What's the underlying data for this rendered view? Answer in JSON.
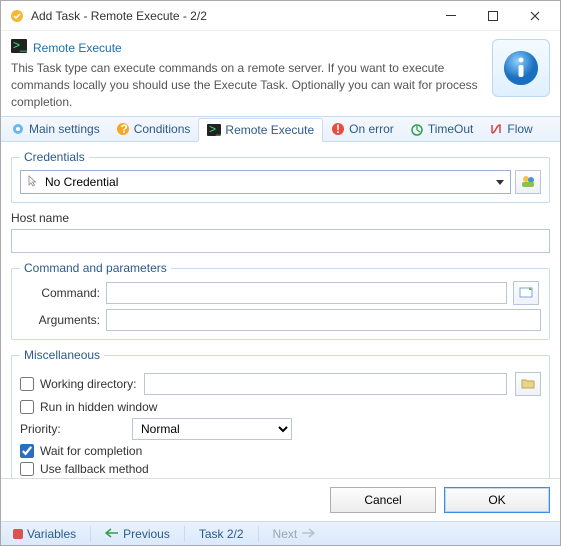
{
  "window": {
    "title": "Add Task - Remote Execute - 2/2"
  },
  "header": {
    "title": "Remote Execute",
    "description": "This Task type can execute commands on a remote server. If you want to execute commands locally you should use the Execute Task. Optionally you can wait for process completion.",
    "info_icon": "info-icon"
  },
  "tabs": [
    {
      "icon": "settings-icon",
      "label": "Main settings",
      "active": false
    },
    {
      "icon": "help-icon",
      "label": "Conditions",
      "active": false
    },
    {
      "icon": "terminal-icon",
      "label": "Remote Execute",
      "active": true
    },
    {
      "icon": "error-icon",
      "label": "On error",
      "active": false
    },
    {
      "icon": "timer-icon",
      "label": "TimeOut",
      "active": false
    },
    {
      "icon": "flow-icon",
      "label": "Flow",
      "active": false
    }
  ],
  "credentials": {
    "legend": "Credentials",
    "selected": "No Credential",
    "manage_icon": "credentials-manager-icon"
  },
  "host": {
    "label": "Host name",
    "value": ""
  },
  "command": {
    "legend": "Command and parameters",
    "command_label": "Command:",
    "command_value": "",
    "browse_icon": "browse-file-icon",
    "arguments_label": "Arguments:",
    "arguments_value": ""
  },
  "misc": {
    "legend": "Miscellaneous",
    "working_dir_label": "Working directory:",
    "working_dir_enabled": false,
    "working_dir_value": "",
    "working_dir_browse_icon": "folder-icon",
    "run_hidden_label": "Run in hidden window",
    "run_hidden_checked": false,
    "priority_label": "Priority:",
    "priority_value": "Normal",
    "wait_label": "Wait for completion",
    "wait_checked": true,
    "fallback_label": "Use fallback method",
    "fallback_checked": false
  },
  "buttons": {
    "cancel": "Cancel",
    "ok": "OK"
  },
  "status": {
    "variables": "Variables",
    "previous": "Previous",
    "task": "Task 2/2",
    "next": "Next"
  }
}
